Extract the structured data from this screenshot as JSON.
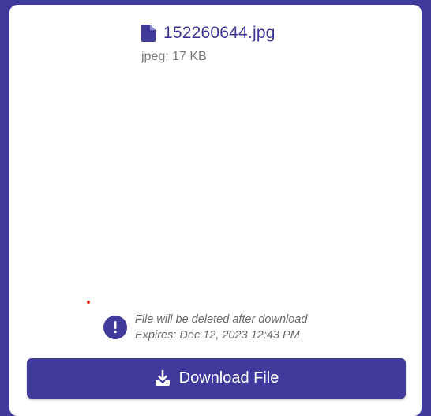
{
  "file": {
    "name": "152260644.jpg",
    "meta": "jpeg; 17 KB"
  },
  "notice": {
    "line1": "File will be deleted after download",
    "line2": "Expires: Dec 12, 2023 12:43 PM"
  },
  "actions": {
    "download_label": "Download File"
  },
  "colors": {
    "background": "#3f3a9b",
    "card": "#ffffff",
    "accent": "#3f3a9b",
    "filename": "#3a3595",
    "muted": "#7a7a7a",
    "alert_dot": "#e0201c"
  },
  "icons": {
    "file": "file-icon",
    "notice": "exclamation-circle-icon",
    "download": "download-icon"
  }
}
